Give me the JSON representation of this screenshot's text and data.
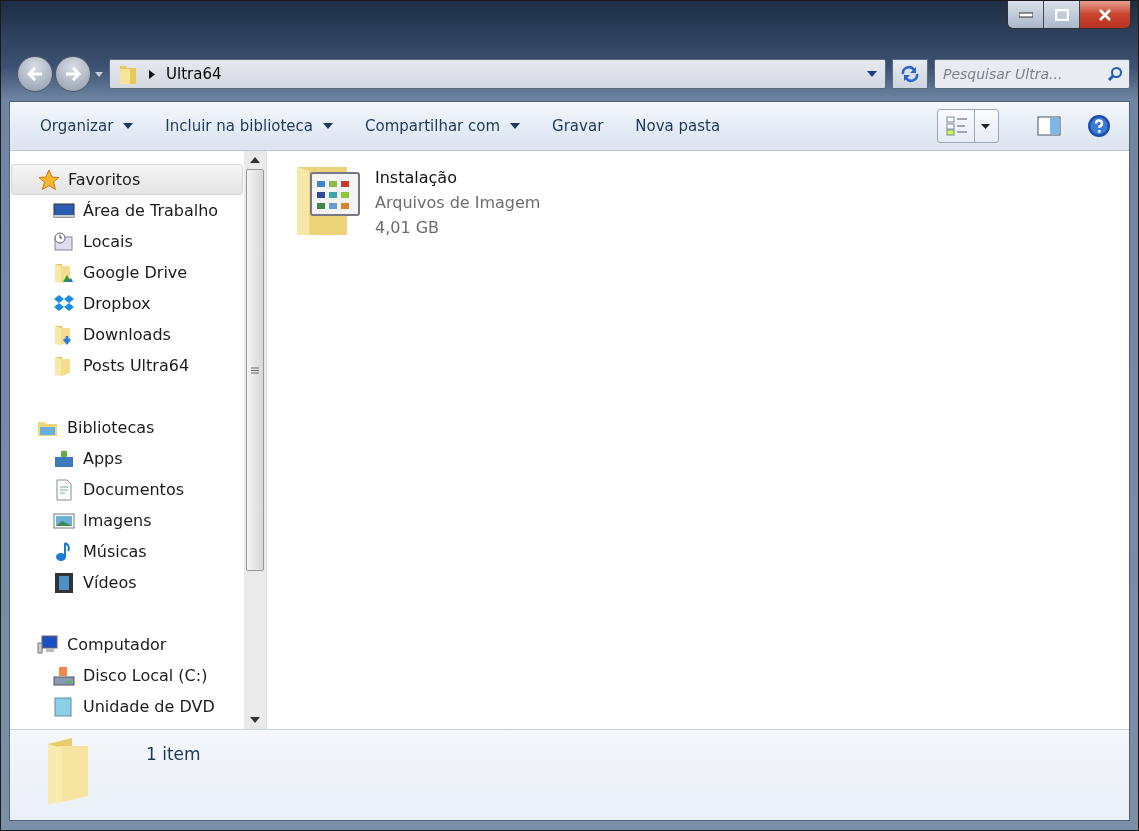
{
  "address_bar": {
    "crumbs": [
      "Ultra64"
    ]
  },
  "search": {
    "placeholder": "Pesquisar Ultra..."
  },
  "toolbar": {
    "buttons": [
      {
        "label": "Organizar",
        "has_menu": true
      },
      {
        "label": "Incluir na biblioteca",
        "has_menu": true
      },
      {
        "label": "Compartilhar com",
        "has_menu": true
      },
      {
        "label": "Gravar",
        "has_menu": false
      },
      {
        "label": "Nova pasta",
        "has_menu": false
      }
    ]
  },
  "navigation": {
    "groups": [
      {
        "label": "Favoritos",
        "selected": true,
        "children": [
          {
            "label": "Área de Trabalho",
            "selected": false
          },
          {
            "label": "Locais",
            "selected": false
          },
          {
            "label": "Google Drive",
            "selected": false
          },
          {
            "label": "Dropbox",
            "selected": false
          },
          {
            "label": "Downloads",
            "selected": false
          },
          {
            "label": "Posts Ultra64",
            "selected": false
          }
        ]
      },
      {
        "label": "Bibliotecas",
        "selected": false,
        "children": [
          {
            "label": "Apps",
            "selected": false
          },
          {
            "label": "Documentos",
            "selected": false
          },
          {
            "label": "Imagens",
            "selected": false
          },
          {
            "label": "Músicas",
            "selected": false
          },
          {
            "label": "Vídeos",
            "selected": false
          }
        ]
      },
      {
        "label": "Computador",
        "selected": false,
        "children": [
          {
            "label": "Disco Local (C:)",
            "selected": false
          },
          {
            "label": "Unidade de DVD",
            "selected": false
          }
        ]
      }
    ]
  },
  "files": [
    {
      "name": "Instalação",
      "type": "Arquivos de Imagem",
      "size": "4,01 GB",
      "selected": false
    }
  ],
  "status_bar": {
    "text": "1 item"
  }
}
